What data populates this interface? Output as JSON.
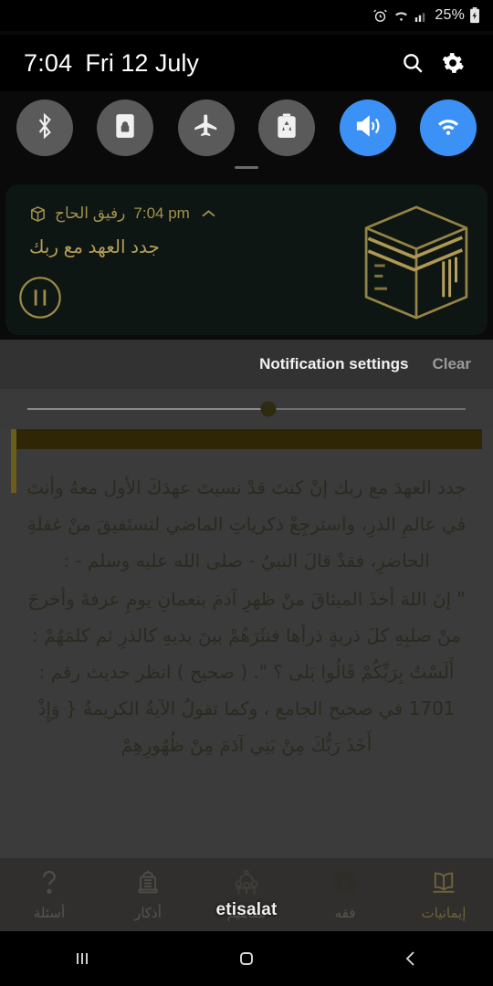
{
  "statusbar": {
    "battery_percent": "25%",
    "icons": [
      "alarm-icon",
      "wifi-icon",
      "signal-icon",
      "battery-charging-icon"
    ]
  },
  "panel_header": {
    "time": "7:04",
    "date": "Fri 12 July",
    "search_icon": "search-icon",
    "settings_icon": "gear-icon"
  },
  "quick_toggles": [
    {
      "name": "bluetooth",
      "icon": "bluetooth-icon",
      "active": false
    },
    {
      "name": "auto-rotate-lock",
      "icon": "rotation-lock-icon",
      "active": false
    },
    {
      "name": "airplane-mode",
      "icon": "airplane-icon",
      "active": false
    },
    {
      "name": "power-saving",
      "icon": "power-saving-icon",
      "active": false
    },
    {
      "name": "sound",
      "icon": "volume-icon",
      "active": true
    },
    {
      "name": "wifi",
      "icon": "wifi-icon",
      "active": true
    }
  ],
  "notification": {
    "app_name": "رفيق الحاج",
    "time": "7:04 pm",
    "title": "جدد العهد مع ربك",
    "app_icon": "kaaba-icon",
    "collapse_icon": "chevron-up-icon",
    "media_button": "pause-icon",
    "artwork": "kaaba-illustration",
    "accent_color": "#a3914f",
    "background_color": "#0d1612"
  },
  "notification_footer": {
    "settings_label": "Notification settings",
    "clear_label": "Clear"
  },
  "brightness": {
    "value": 55,
    "label": "brightness-slider"
  },
  "app_content": {
    "paragraphs": [
      "جدد العهدَ مع ربك إنْ كنتَ قدْ نسيتَ عهدَكَ الأول معهُ وأنتَ في عالمِ الذرِ، واسترجِعْ ذكرياتِ الماضي لتستَفيقَ منْ غفلةِ الحاضرِ، فقدْ قالَ النبيُ - صلى الله عليه وسلم - :",
      "\" إنَ اللهَ أخذَ الميثاقَ منْ ظهرِ آدمَ بنعمانِ يومِ عرفةَ وأخرجَ منْ صلبِهِ كلَ ذريةٍ ذرأها فنثَرَهُمْ بينَ يديهِ كالذرِ ثم كلمَهُمْ : أَلَسْتُ بِرَبِّكُمْ قَالُوا بَلى ؟ \". ( صحيح ) انظر حديث رقم : 1701 في صحيح الجامع ، وكما تقولُ الآيةُ الكريمةُ { وَإِذْ أَخَذَ رَبُّكَ مِنْ بَنِي آدَمَ مِنْ ظُهُورِهِمْ"
    ]
  },
  "app_nav": {
    "carrier_overlay": "etisalat",
    "items": [
      {
        "label": "أسئلة",
        "icon": "question-mark-icon",
        "active": false
      },
      {
        "label": "أذكار",
        "icon": "lantern-icon",
        "active": false
      },
      {
        "label": "مفاهيم",
        "icon": "mosque-icon",
        "active": false
      },
      {
        "label": "فقه",
        "icon": "geometric-star-icon",
        "active": false
      },
      {
        "label": "إيمانيات",
        "icon": "open-book-icon",
        "active": true
      }
    ]
  },
  "system_nav": {
    "recents": "recents-icon",
    "home": "home-icon",
    "back": "back-icon"
  }
}
